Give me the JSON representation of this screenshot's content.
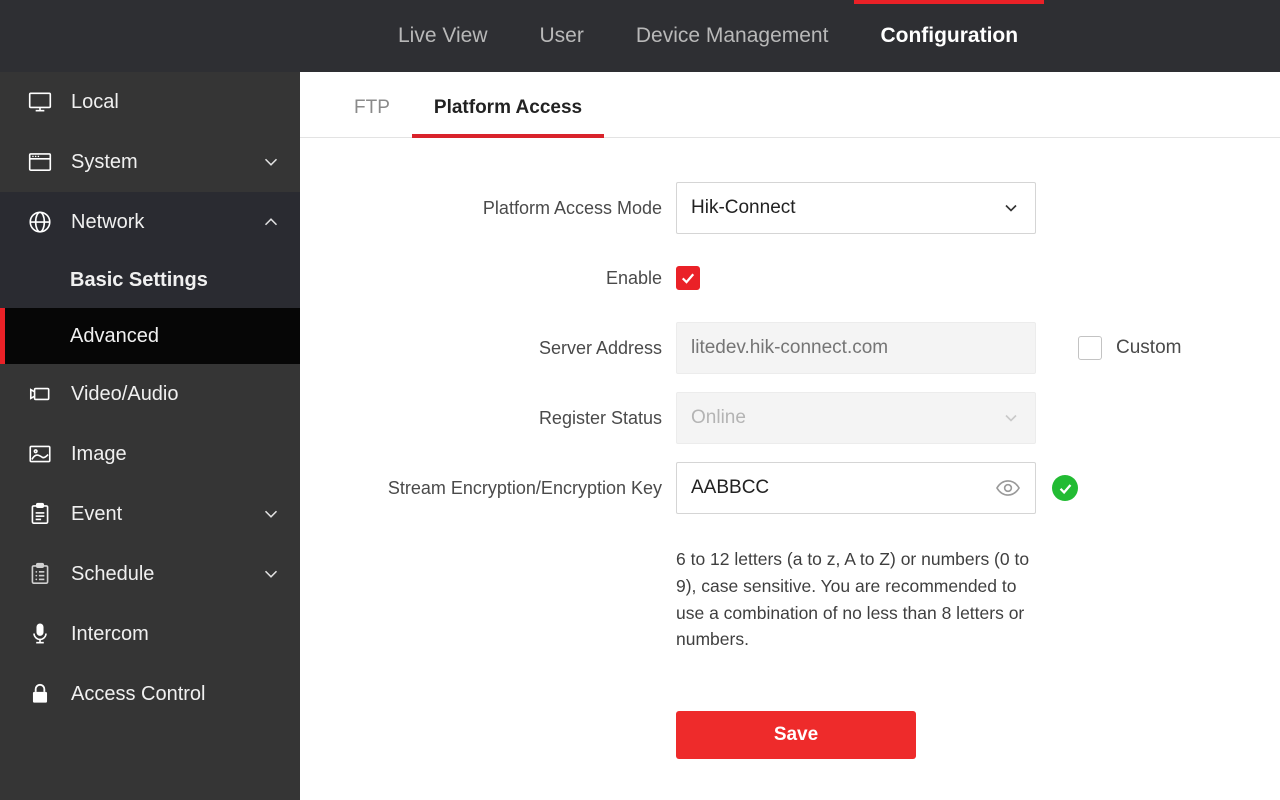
{
  "topnav": {
    "items": [
      {
        "label": "Live View",
        "active": false
      },
      {
        "label": "User",
        "active": false
      },
      {
        "label": "Device Management",
        "active": false
      },
      {
        "label": "Configuration",
        "active": true
      }
    ],
    "accent_color": "#ea2127",
    "background_color": "#2e2f33"
  },
  "sidebar": {
    "background_color": "#353535",
    "active_background_color": "#060606",
    "items": [
      {
        "label": "Local",
        "icon": "monitor-icon",
        "expandable": false
      },
      {
        "label": "System",
        "icon": "window-icon",
        "expandable": true,
        "expanded": false
      },
      {
        "label": "Network",
        "icon": "globe-icon",
        "expandable": true,
        "expanded": true
      },
      {
        "label": "Video/Audio",
        "icon": "camera-icon",
        "expandable": false
      },
      {
        "label": "Image",
        "icon": "picture-icon",
        "expandable": false
      },
      {
        "label": "Event",
        "icon": "clipboard-icon",
        "expandable": true,
        "expanded": false
      },
      {
        "label": "Schedule",
        "icon": "clipboard-list-icon",
        "expandable": true,
        "expanded": false
      },
      {
        "label": "Intercom",
        "icon": "microphone-icon",
        "expandable": false
      },
      {
        "label": "Access Control",
        "icon": "lock-icon",
        "expandable": false
      }
    ],
    "network_submenu": [
      {
        "label": "Basic Settings",
        "active": false
      },
      {
        "label": "Advanced",
        "active": true
      }
    ]
  },
  "tabs": [
    {
      "label": "FTP",
      "active": false
    },
    {
      "label": "Platform Access",
      "active": true
    }
  ],
  "form": {
    "platform_access_mode": {
      "label": "Platform Access Mode",
      "value": "Hik-Connect",
      "disabled": false
    },
    "enable": {
      "label": "Enable",
      "checked": true
    },
    "server_address": {
      "label": "Server Address",
      "placeholder": "litedev.hik-connect.com",
      "value": "",
      "disabled": true
    },
    "custom": {
      "label": "Custom",
      "checked": false
    },
    "register_status": {
      "label": "Register Status",
      "value": "Online",
      "disabled": true
    },
    "encryption_key": {
      "label": "Stream Encryption/Encryption Key",
      "value": "AABBCC",
      "disabled": false,
      "status": "valid"
    },
    "hint": "6 to 12 letters (a to z, A to Z) or numbers (0 to 9), case sensitive. You are recommended to use a combination of no less than 8 letters or numbers.",
    "save_label": "Save",
    "save_color": "#ee2b2b"
  }
}
